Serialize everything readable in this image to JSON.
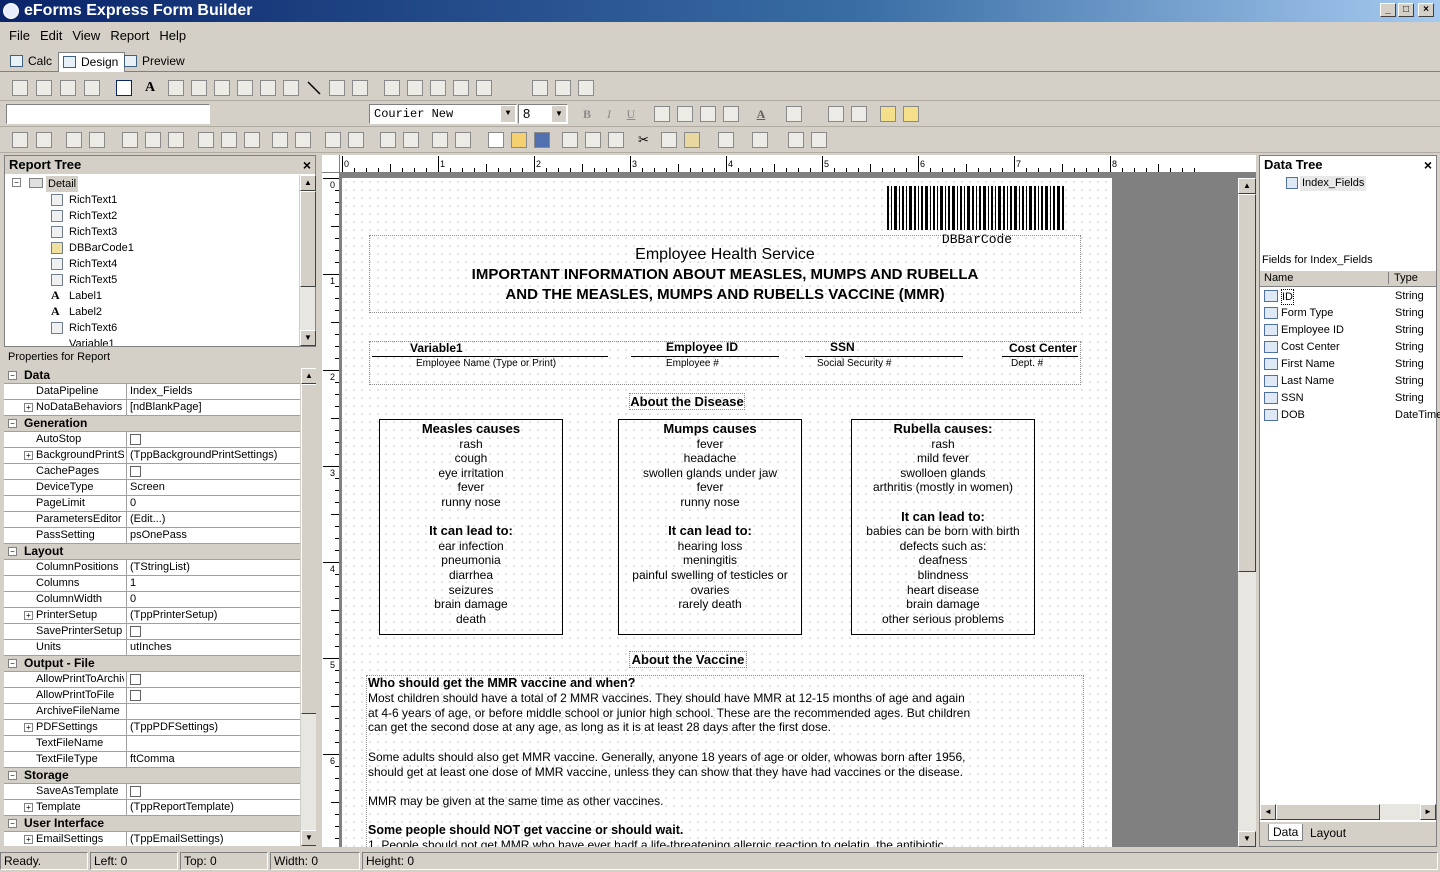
{
  "window": {
    "title": "eForms Express Form Builder"
  },
  "menu": [
    "File",
    "Edit",
    "View",
    "Report",
    "Help"
  ],
  "mode_tabs": [
    "Calc",
    "Design",
    "Preview"
  ],
  "toolbar": {
    "font_name": "Courier New",
    "font_size": "8",
    "bold": "B",
    "italic": "I",
    "underline": "U",
    "font_color": "A"
  },
  "report_tree": {
    "title": "Report Tree",
    "root": "Detail",
    "items": [
      "RichText1",
      "RichText2",
      "RichText3",
      "DBBarCode1",
      "RichText4",
      "RichText5",
      "Label1",
      "Label2",
      "RichText6",
      "Variable1"
    ]
  },
  "properties": {
    "title": "Properties for Report",
    "categories": [
      {
        "name": "Data",
        "rows": [
          {
            "name": "DataPipeline",
            "value": "Index_Fields"
          },
          {
            "name": "NoDataBehaviors",
            "value": "[ndBlankPage]"
          }
        ]
      },
      {
        "name": "Generation",
        "rows": [
          {
            "name": "AutoStop",
            "value": ""
          },
          {
            "name": "BackgroundPrintSettings",
            "value": "(TppBackgroundPrintSettings)"
          },
          {
            "name": "CachePages",
            "value": ""
          },
          {
            "name": "DeviceType",
            "value": "Screen"
          },
          {
            "name": "PageLimit",
            "value": "0"
          },
          {
            "name": "ParametersEditor",
            "value": "(Edit...)"
          },
          {
            "name": "PassSetting",
            "value": "psOnePass"
          }
        ]
      },
      {
        "name": "Layout",
        "rows": [
          {
            "name": "ColumnPositions",
            "value": "(TStringList)"
          },
          {
            "name": "Columns",
            "value": "1"
          },
          {
            "name": "ColumnWidth",
            "value": "0"
          },
          {
            "name": "PrinterSetup",
            "value": "(TppPrinterSetup)"
          },
          {
            "name": "SavePrinterSetup",
            "value": ""
          },
          {
            "name": "Units",
            "value": "utInches"
          }
        ]
      },
      {
        "name": "Output - File",
        "rows": [
          {
            "name": "AllowPrintToArchive",
            "value": ""
          },
          {
            "name": "AllowPrintToFile",
            "value": ""
          },
          {
            "name": "ArchiveFileName",
            "value": ""
          },
          {
            "name": "PDFSettings",
            "value": "(TppPDFSettings)"
          },
          {
            "name": "TextFileName",
            "value": ""
          },
          {
            "name": "TextFileType",
            "value": "ftComma"
          }
        ]
      },
      {
        "name": "Storage",
        "rows": [
          {
            "name": "SaveAsTemplate",
            "value": ""
          },
          {
            "name": "Template",
            "value": "(TppReportTemplate)"
          }
        ]
      },
      {
        "name": "User Interface",
        "rows": [
          {
            "name": "EmailSettings",
            "value": "(TppEmailSettings)"
          }
        ]
      }
    ]
  },
  "ruler": {
    "h": [
      "0",
      "1",
      "2",
      "3",
      "4",
      "5",
      "6",
      "7",
      "8"
    ],
    "v": [
      "0",
      "1",
      "2",
      "3",
      "4",
      "5",
      "6"
    ]
  },
  "form": {
    "barcode_label": "DBBarCode",
    "header1": "Employee Health Service",
    "header2": "IMPORTANT INFORMATION ABOUT MEASLES, MUMPS AND RUBELLA",
    "header3": "AND THE MEASLES, MUMPS AND RUBELLS VACCINE (MMR)",
    "fields": [
      {
        "value": "Variable1",
        "label": "Employee Name (Type or Print)"
      },
      {
        "value": "Employee ID",
        "label": "Employee #"
      },
      {
        "value": "SSN",
        "label": "Social Security #"
      },
      {
        "value": "Cost Center",
        "label": "Dept. #"
      }
    ],
    "about_disease": "About the Disease",
    "boxes": [
      {
        "title": "Measles causes",
        "symptoms": [
          "rash",
          "cough",
          "eye irritation",
          "fever",
          "runny nose"
        ],
        "lead": "It can lead to:",
        "results": [
          "ear infection",
          "pneumonia",
          "diarrhea",
          "seizures",
          "brain damage",
          "death"
        ]
      },
      {
        "title": "Mumps causes",
        "symptoms": [
          "fever",
          "headache",
          "swollen glands under jaw",
          "fever",
          "runny nose"
        ],
        "lead": "It can lead to:",
        "results": [
          "hearing loss",
          "meningitis",
          "painful swelling of testicles or",
          "ovaries",
          "rarely death"
        ]
      },
      {
        "title": "Rubella causes:",
        "symptoms": [
          "rash",
          "mild fever",
          "swolloen glands",
          "arthritis (mostly in women)"
        ],
        "lead": "It can lead to:",
        "results": [
          "babies can be born with birth",
          "defects such as:",
          "deafness",
          "blindness",
          "heart disease",
          "brain damage",
          "other serious problems"
        ]
      }
    ],
    "about_vaccine": "About the Vaccine",
    "q1": "Who should get the MMR vaccine and when?",
    "p1": [
      "Most children should have a total of 2 MMR vaccines.  They should have MMR at 12-15 months of age and again",
      "at 4-6 years of age, or before middle school or junior high school.  These are the recommended ages.  But children",
      "can get the second dose at any age, as long as it is at least 28 days after the first dose."
    ],
    "p2": [
      "Some adults should also get MMR vaccine.  Generally, anyone 18 years of age or older, whowas born after 1956,",
      "should get at least one dose of MMR vaccine, unless they can show that they have had vaccines or the disease."
    ],
    "p3": "MMR may be given at the same time as other vaccines.",
    "q2": "Some people should NOT get vaccine or should wait.",
    "p4": "1.        People should not get MMR who have ever hadf a life-threatening allergic reaction to gelatin, the antibiotic"
  },
  "data_tree": {
    "title": "Data Tree",
    "root": "Index_Fields",
    "fields_title": "Fields for Index_Fields",
    "col_name": "Name",
    "col_type": "Type",
    "fields": [
      {
        "name": "ID",
        "type": "String"
      },
      {
        "name": "Form Type",
        "type": "String"
      },
      {
        "name": "Employee ID",
        "type": "String"
      },
      {
        "name": "Cost Center",
        "type": "String"
      },
      {
        "name": "First Name",
        "type": "String"
      },
      {
        "name": "Last Name",
        "type": "String"
      },
      {
        "name": "SSN",
        "type": "String"
      },
      {
        "name": "DOB",
        "type": "DateTime"
      }
    ],
    "tabs": [
      "Data",
      "Layout"
    ]
  },
  "status": {
    "ready": "Ready.",
    "left": "Left: 0",
    "top": "Top: 0",
    "width": "Width: 0",
    "height": "Height: 0"
  }
}
